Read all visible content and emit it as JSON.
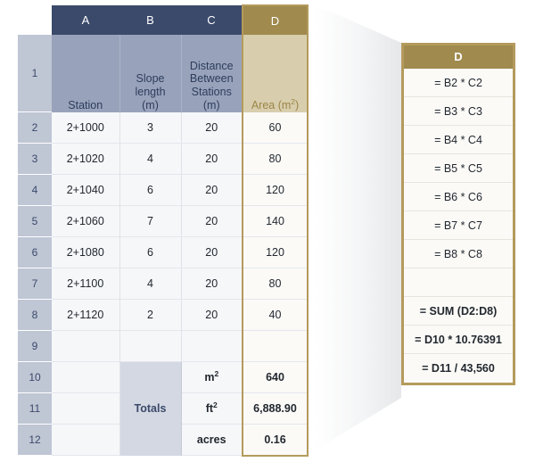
{
  "colors": {
    "header_blue": "#3b4a6b",
    "header_blue_light": "#98a3bb",
    "gold_border": "#b49a5c",
    "gold_header": "#a08a4e",
    "gold_cell": "#d8cead",
    "rownum_gray": "#bfc6d4",
    "totals_gray": "#d3d8e2"
  },
  "sheet": {
    "column_letters": [
      "A",
      "B",
      "C",
      "D"
    ],
    "row_numbers": [
      "1",
      "2",
      "3",
      "4",
      "5",
      "6",
      "7",
      "8",
      "9",
      "10",
      "11",
      "12"
    ],
    "headers": {
      "a": "Station",
      "b_line1": "Slope",
      "b_line2": "length",
      "b_line3": "(m)",
      "c_line1": "Distance",
      "c_line2": "Between",
      "c_line3": "Stations",
      "c_line4": "(m)",
      "d_text": "Area (m",
      "d_sup": "2",
      "d_close": ")"
    },
    "rows": [
      {
        "num": "2",
        "a": "2+1000",
        "b": "3",
        "c": "20",
        "d": "60"
      },
      {
        "num": "3",
        "a": "2+1020",
        "b": "4",
        "c": "20",
        "d": "80"
      },
      {
        "num": "4",
        "a": "2+1040",
        "b": "6",
        "c": "20",
        "d": "120"
      },
      {
        "num": "5",
        "a": "2+1060",
        "b": "7",
        "c": "20",
        "d": "140"
      },
      {
        "num": "6",
        "a": "2+1080",
        "b": "6",
        "c": "20",
        "d": "120"
      },
      {
        "num": "7",
        "a": "2+1100",
        "b": "4",
        "c": "20",
        "d": "80"
      },
      {
        "num": "8",
        "a": "2+1120",
        "b": "2",
        "c": "20",
        "d": "40"
      },
      {
        "num": "9",
        "a": "",
        "b": "",
        "c": "",
        "d": ""
      }
    ],
    "totals": {
      "label": "Totals",
      "rows": [
        {
          "num": "10",
          "unit_text": "m",
          "unit_sup": "2",
          "value": "640"
        },
        {
          "num": "11",
          "unit_text": "ft",
          "unit_sup": "2",
          "value": "6,888.90"
        },
        {
          "num": "12",
          "unit_text": "acres",
          "unit_sup": "",
          "value": "0.16"
        }
      ]
    }
  },
  "formula_panel": {
    "header": "D",
    "rows": [
      {
        "text": "= B2 * C2",
        "bold": false
      },
      {
        "text": "= B3 * C3",
        "bold": false
      },
      {
        "text": "= B4 * C4",
        "bold": false
      },
      {
        "text": "= B5 * C5",
        "bold": false
      },
      {
        "text": "= B6 * C6",
        "bold": false
      },
      {
        "text": "= B7 * C7",
        "bold": false
      },
      {
        "text": "= B8 * C8",
        "bold": false
      },
      {
        "text": "",
        "bold": false
      },
      {
        "text": "= SUM (D2:D8)",
        "bold": true
      },
      {
        "text": "= D10 * 10.76391",
        "bold": true
      },
      {
        "text": "= D11 / 43,560",
        "bold": true
      }
    ]
  }
}
